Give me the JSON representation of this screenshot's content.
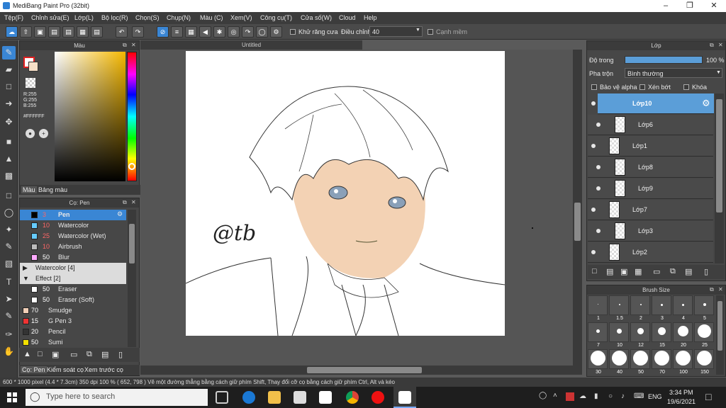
{
  "app": {
    "title": "MediBang Paint Pro (32bit)"
  },
  "menu": [
    "Tệp(F)",
    "Chỉnh sửa(E)",
    "Lớp(L)",
    "Bộ lọc(R)",
    "Chọn(S)",
    "Chụp(N)",
    "Màu (C)",
    "Xem(V)",
    "Công cụ(T)",
    "Cửa số(W)",
    "Cloud",
    "Help"
  ],
  "toolbar": {
    "antialias_label": "Khử răng cưa",
    "correction_label": "Điều chỉnh",
    "correction_value": "40",
    "edge_label": "Cạnh mềm"
  },
  "color_panel": {
    "title": "Màu",
    "r": "R:255",
    "g": "G:255",
    "b": "B:255",
    "hex": "#FFFFFF",
    "tab1": "Màu",
    "tab2": "Bảng màu"
  },
  "brush_panel": {
    "title": "Cọ: Pen",
    "rows": [
      {
        "size": "3",
        "name": "Pen",
        "color": "#000000",
        "selected": true
      },
      {
        "size": "10",
        "name": "Watercolor",
        "color": "#66ccff"
      },
      {
        "size": "25",
        "name": "Watercolor (Wet)",
        "color": "#66ccff"
      },
      {
        "size": "10",
        "name": "Airbrush",
        "color": "#bbbbbb"
      },
      {
        "size": "50",
        "name": "Blur",
        "color": "#ffaaff"
      }
    ],
    "group1": "Watercolor [4]",
    "group2": "Effect [2]",
    "rows2": [
      {
        "size": "50",
        "name": "Eraser",
        "color": "#ffffff"
      },
      {
        "size": "50",
        "name": "Eraser (Soft)",
        "color": "#ffffff"
      }
    ],
    "rows3": [
      {
        "size": "70",
        "name": "Smudge",
        "color": "#f2d0b8"
      },
      {
        "size": "15",
        "name": "G Pen 3",
        "color": "#ee3333"
      },
      {
        "size": "20",
        "name": "Pencil",
        "color": "#333333"
      },
      {
        "size": "50",
        "name": "Sumi",
        "color": "#f2e000"
      }
    ],
    "tabs": [
      "Cọ: Pen",
      "Kiểm soát cọ",
      "Xem trước cọ"
    ]
  },
  "canvas": {
    "tab": "Untitled",
    "signature": "@tb"
  },
  "layer_panel": {
    "title": "Lớp",
    "opacity_label": "Độ trong",
    "opacity_value": "100 %",
    "blend_label": "Pha trộn",
    "blend_value": "Bình thường",
    "protect_alpha": "Bảo vệ alpha",
    "clipping": "Xén bớt",
    "lock": "Khóa",
    "layers": [
      "Lớp10",
      "Lớp6",
      "Lớp1",
      "Lớp8",
      "Lớp9",
      "Lớp7",
      "Lớp3",
      "Lớp2"
    ]
  },
  "brush_size_panel": {
    "title": "Brush Size",
    "sizes": [
      "1",
      "1.5",
      "2",
      "3",
      "4",
      "5",
      "7",
      "10",
      "12",
      "15",
      "20",
      "25",
      "30",
      "40",
      "50",
      "70",
      "100",
      "150"
    ]
  },
  "status": {
    "text": "600 * 1000 pixel  (4.4 * 7.3cm)  350 dpi  100 %  ( 652, 798 )  Vẽ một đường thẳng bằng cách giữ phím Shift, Thay đổi cỡ cọ bằng cách giữ phím Ctrl, Alt và kéo"
  },
  "taskbar": {
    "search_placeholder": "Type here to search",
    "lang": "ENG",
    "time": "3:34 PM",
    "date": "19/6/2021"
  }
}
